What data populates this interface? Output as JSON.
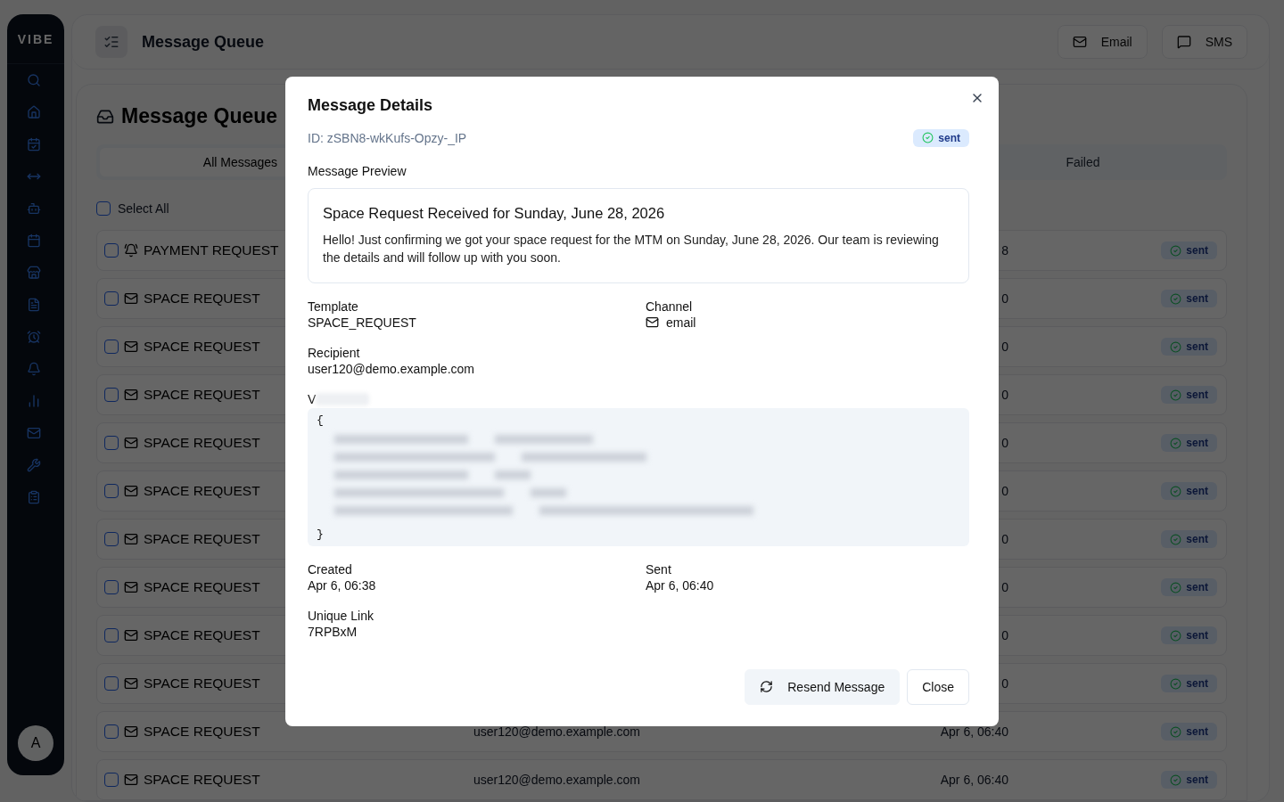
{
  "sidebar": {
    "logo": "VIBE",
    "avatar": "A"
  },
  "header": {
    "title": "Message Queue",
    "buttons": [
      {
        "kind": "email",
        "label": "Email"
      },
      {
        "kind": "sms",
        "label": "SMS"
      }
    ]
  },
  "queue": {
    "title": "Message Queue",
    "tabs": [
      {
        "label": "All Messages",
        "selected": true
      },
      {
        "label": "Failed",
        "selected": false
      }
    ],
    "select_all": {
      "label": "Select All",
      "checked": false
    },
    "rows": [
      {
        "kind": "payment",
        "template": "PAYMENT REQUEST",
        "date": "8",
        "status": "sent",
        "checked": false
      },
      {
        "kind": "email",
        "template": "SPACE REQUEST",
        "date": "0",
        "status": "sent",
        "checked": false
      },
      {
        "kind": "email",
        "template": "SPACE REQUEST",
        "date": "0",
        "status": "sent",
        "checked": false
      },
      {
        "kind": "email",
        "template": "SPACE REQUEST",
        "date": "0",
        "status": "sent",
        "checked": false
      },
      {
        "kind": "email",
        "template": "SPACE REQUEST",
        "date": "0",
        "status": "sent",
        "checked": false
      },
      {
        "kind": "email",
        "template": "SPACE REQUEST",
        "date": "0",
        "status": "sent",
        "checked": false
      },
      {
        "kind": "email",
        "template": "SPACE REQUEST",
        "date": "0",
        "status": "sent",
        "checked": false
      },
      {
        "kind": "email",
        "template": "SPACE REQUEST",
        "date": "0",
        "status": "sent",
        "checked": false
      },
      {
        "kind": "email",
        "template": "SPACE REQUEST",
        "date": "0",
        "status": "sent",
        "checked": false
      },
      {
        "kind": "email",
        "template": "SPACE REQUEST",
        "date": "0",
        "status": "sent",
        "checked": false
      },
      {
        "kind": "email",
        "template": "SPACE REQUEST",
        "recipient": "user120@demo.example.com",
        "date": "Apr 6, 06:40",
        "status": "sent",
        "checked": false
      },
      {
        "kind": "email",
        "template": "SPACE REQUEST",
        "recipient": "user120@demo.example.com",
        "date": "Apr 6, 06:40",
        "status": "sent",
        "checked": false
      }
    ]
  },
  "dialog": {
    "title": "Message Details",
    "id": "ID: zSBN8-wkKufs-Opzy-_IP",
    "status": "sent",
    "preview_label": "Message Preview",
    "preview_subject": "Space Request Received for Sunday, June 28, 2026",
    "preview_body": "Hello! Just confirming we got your space request for the MTM on Sunday, June 28, 2026. Our team is reviewing the details and will follow up with you soon.",
    "fields": [
      {
        "label": "Template",
        "value": "SPACE_REQUEST"
      },
      {
        "label": "Channel",
        "value": "email",
        "kind": "channel"
      },
      {
        "label": "Recipient",
        "value": "user120@demo.example.com"
      }
    ],
    "variables": {
      "label": "V",
      "open": "{",
      "close": "}"
    },
    "times": [
      {
        "label": "Created",
        "value": "Apr 6, 06:38"
      },
      {
        "label": "Sent",
        "value": "Apr 6, 06:40"
      },
      {
        "label": "Unique Link",
        "value": "7RPBxM"
      }
    ],
    "buttons": [
      {
        "kind": "resend",
        "label": "Resend Message"
      },
      {
        "kind": "close",
        "label": "Close"
      }
    ]
  }
}
